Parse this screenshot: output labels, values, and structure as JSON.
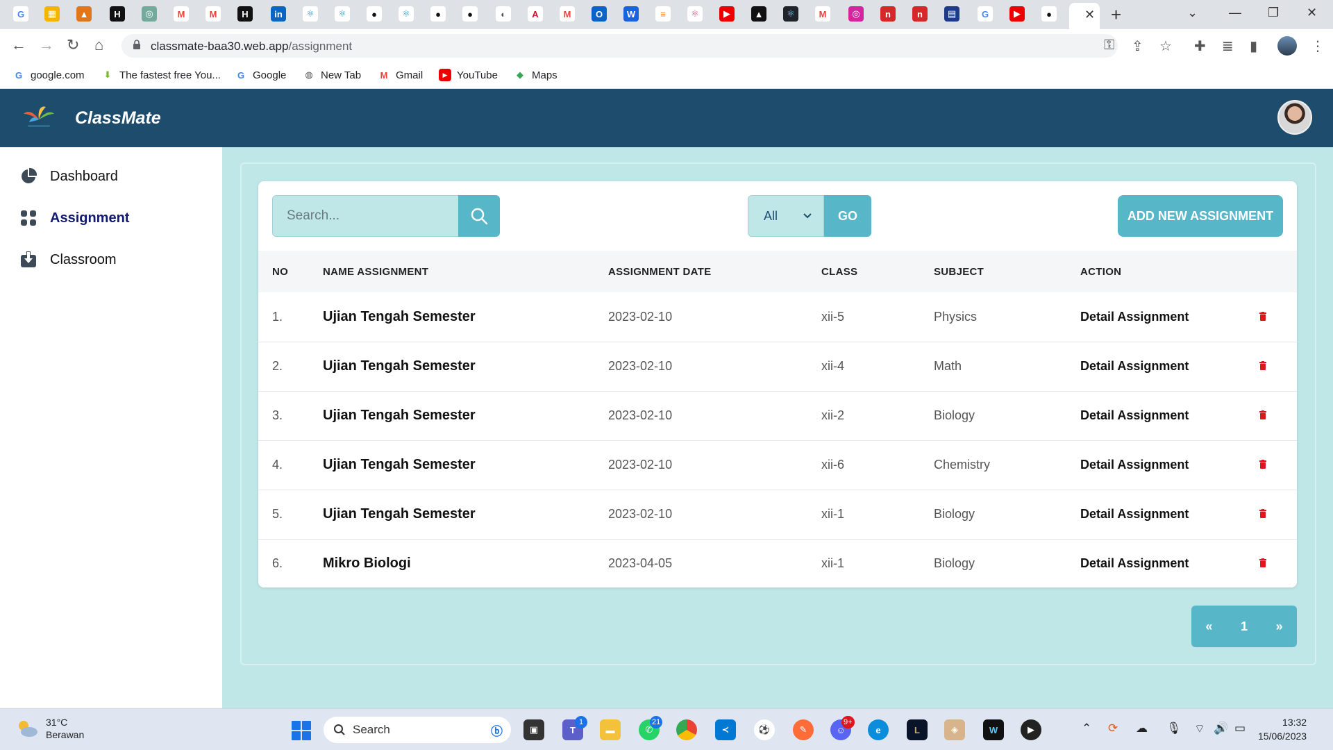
{
  "browser": {
    "url_host": "classmate-baa30.web.app",
    "url_path": "/assignment",
    "bookmarks": [
      "google.com",
      "The fastest free You...",
      "Google",
      "New Tab",
      "Gmail",
      "YouTube",
      "Maps"
    ]
  },
  "app": {
    "brand": "ClassMate",
    "colors": {
      "header": "#1d4c6c",
      "accent": "#58b6c9",
      "background": "#bfe7e7",
      "active_nav": "#101a6e",
      "delete": "#e0151d"
    }
  },
  "sidebar": {
    "items": [
      {
        "label": "Dashboard",
        "icon": "pie-chart-icon"
      },
      {
        "label": "Assignment",
        "icon": "grid-icon"
      },
      {
        "label": "Classroom",
        "icon": "download-box-icon"
      }
    ]
  },
  "toolbar": {
    "search_placeholder": "Search...",
    "filter_value": "All",
    "go_label": "GO",
    "add_label": "ADD NEW ASSIGNMENT"
  },
  "table": {
    "headers": [
      "NO",
      "NAME ASSIGNMENT",
      "ASSIGNMENT DATE",
      "CLASS",
      "SUBJECT",
      "ACTION"
    ],
    "rows": [
      {
        "no": "1.",
        "name": "Ujian Tengah Semester",
        "date": "2023-02-10",
        "class": "xii-5",
        "subject": "Physics",
        "action": "Detail Assignment"
      },
      {
        "no": "2.",
        "name": "Ujian Tengah Semester",
        "date": "2023-02-10",
        "class": "xii-4",
        "subject": "Math",
        "action": "Detail Assignment"
      },
      {
        "no": "3.",
        "name": "Ujian Tengah Semester",
        "date": "2023-02-10",
        "class": "xii-2",
        "subject": "Biology",
        "action": "Detail Assignment"
      },
      {
        "no": "4.",
        "name": "Ujian Tengah Semester",
        "date": "2023-02-10",
        "class": "xii-6",
        "subject": "Chemistry",
        "action": "Detail Assignment"
      },
      {
        "no": "5.",
        "name": "Ujian Tengah Semester",
        "date": "2023-02-10",
        "class": "xii-1",
        "subject": "Biology",
        "action": "Detail Assignment"
      },
      {
        "no": "6.",
        "name": "Mikro Biologi",
        "date": "2023-04-05",
        "class": "xii-1",
        "subject": "Biology",
        "action": "Detail Assignment"
      }
    ]
  },
  "pagination": {
    "prev": "«",
    "page": "1",
    "next": "»"
  },
  "taskbar": {
    "weather_temp": "31°C",
    "weather_desc": "Berawan",
    "search_label": "Search",
    "badge_teams": "1",
    "badge_whatsapp": "21",
    "badge_discord": "9+",
    "time": "13:32",
    "date": "15/06/2023"
  }
}
